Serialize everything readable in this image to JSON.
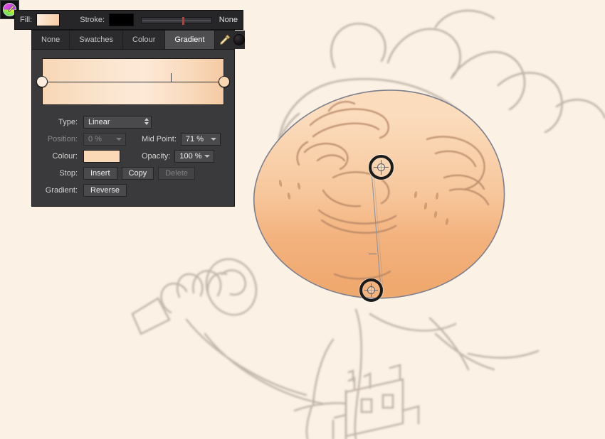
{
  "app": {
    "canvas_background": "#fbf1e4",
    "panel_background": "#3a3a3c"
  },
  "fill_strip": {
    "fill_label": "Fill:",
    "fill_colour": "#f7d2ae",
    "stroke_label": "Stroke:",
    "stroke_colour": "#000000",
    "stroke_width_none_label": "None",
    "stroke_slider_position_pct": 58
  },
  "tabs": [
    {
      "label": "None",
      "active": false
    },
    {
      "label": "Swatches",
      "active": false
    },
    {
      "label": "Colour",
      "active": false
    },
    {
      "label": "Gradient",
      "active": true
    }
  ],
  "tab_tools": {
    "eyedropper_icon": "eyedropper-icon",
    "swatch_icon": "dark-colour-swatch"
  },
  "gradient_preview": {
    "start_colour": "#f8d7b6",
    "mid_colour": "#fbe3cd",
    "end_colour": "#f6ceaa",
    "mid_point_pct": 71,
    "start_stop_colour": "#fbeee1",
    "end_stop_colour": "#f7d6b4"
  },
  "controls": {
    "type_label": "Type:",
    "type_value": "Linear",
    "position_label": "Position:",
    "position_value": "0 %",
    "position_disabled": true,
    "mid_point_label": "Mid Point:",
    "mid_point_value": "71 %",
    "colour_label": "Colour:",
    "colour_value": "#fbd9b6",
    "opacity_label": "Opacity:",
    "opacity_value": "100 %",
    "stop_label": "Stop:",
    "stop_insert_label": "Insert",
    "stop_copy_label": "Copy",
    "stop_delete_label": "Delete",
    "stop_delete_disabled": true,
    "gradient_label": "Gradient:",
    "gradient_reverse_label": "Reverse"
  },
  "canvas_overlay": {
    "start_handle_label": "gradient-start-handle",
    "end_handle_label": "gradient-end-handle",
    "midpoint_tick_label": "gradient-midpoint-tick",
    "cursor_badge_label": "colour-wheel-cursor"
  },
  "artwork": {
    "description": "pencil sketch of a chef character holding a spoon, head filled with peach gradient",
    "sketch_colour": "#b3a79d",
    "skin_light": "#f9d6b3",
    "skin_dark": "#f0a86f"
  }
}
